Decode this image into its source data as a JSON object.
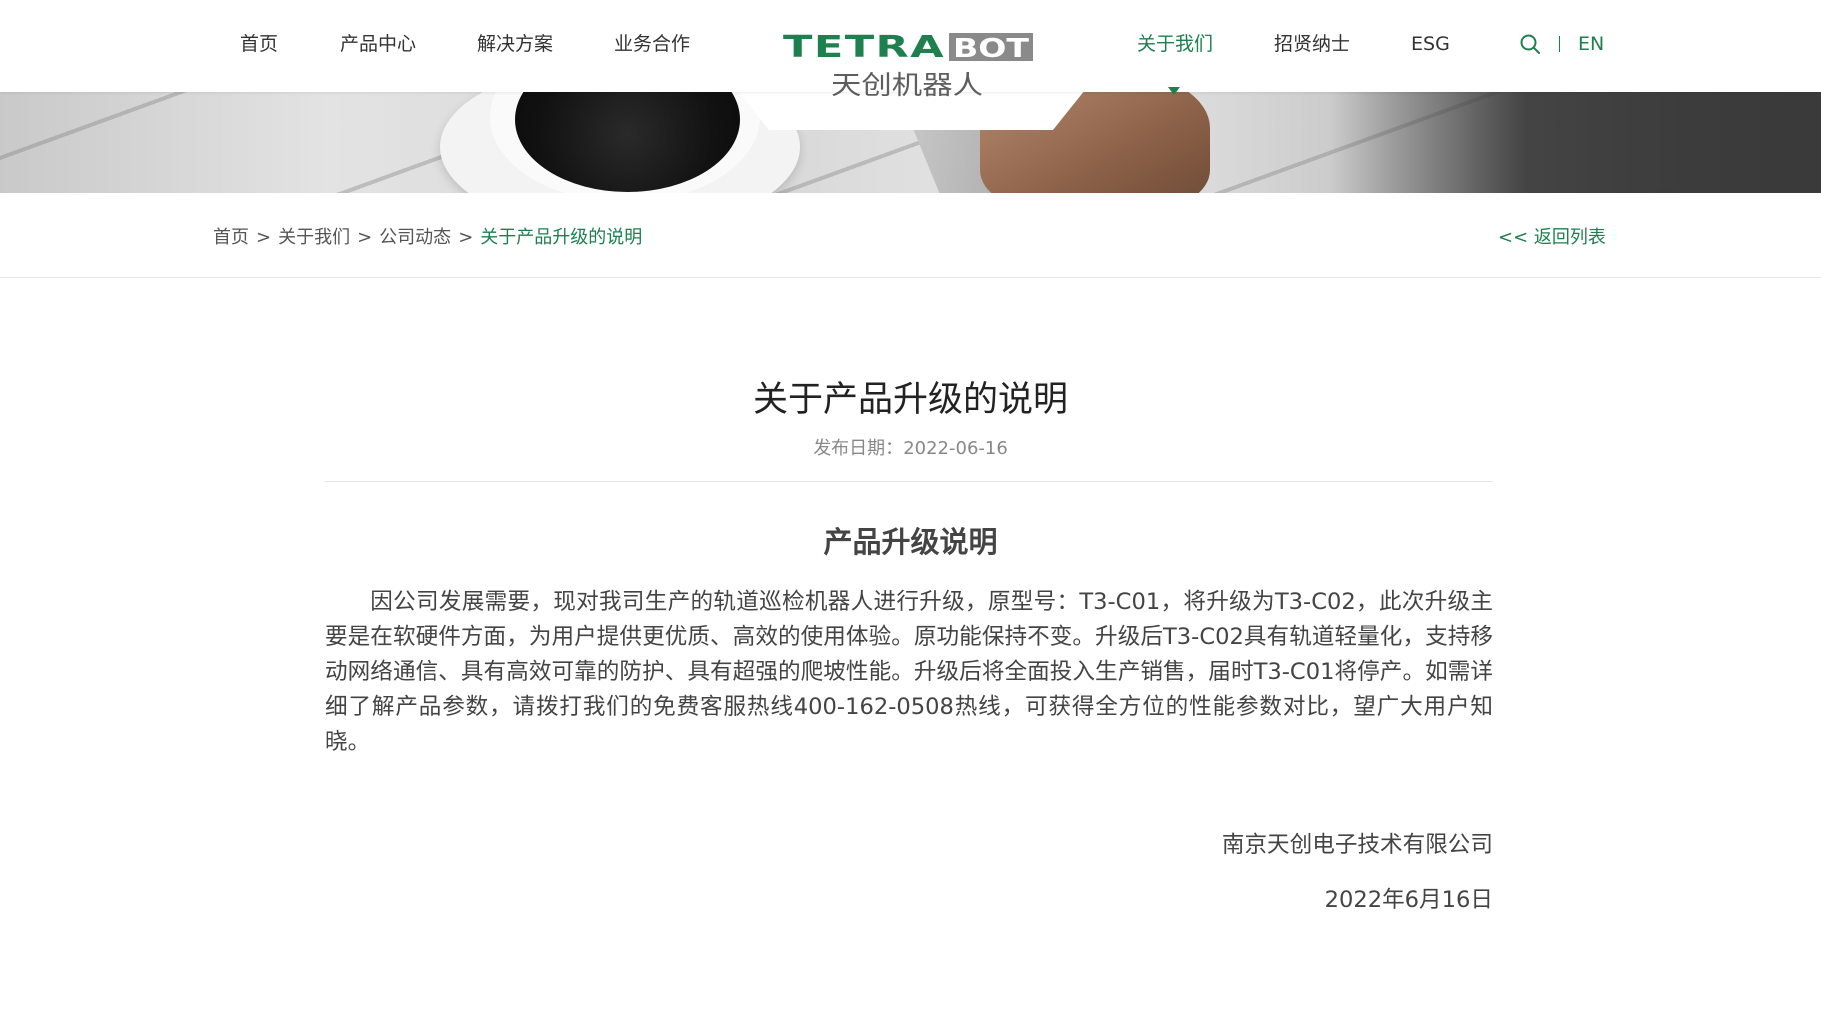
{
  "header": {
    "nav_left": [
      "首页",
      "产品中心",
      "解决方案",
      "业务合作"
    ],
    "nav_right": [
      "关于我们",
      "招贤纳士",
      "ESG"
    ],
    "active_nav": "关于我们",
    "logo": {
      "en": "TETRABOT",
      "cn": "天创机器人"
    },
    "lang": "EN",
    "icons": {
      "search": "search-icon"
    },
    "colors": {
      "accent": "#1e7f4f",
      "logo_green": "#1e7f4f",
      "logo_gray": "#8a8a8a"
    }
  },
  "breadcrumb": {
    "items": [
      "首页",
      "关于我们",
      "公司动态"
    ],
    "separator": ">",
    "current": "关于产品升级的说明"
  },
  "back_link": "<< 返回列表",
  "article": {
    "title": "关于产品升级的说明",
    "date_label": "发布日期：",
    "date": "2022-06-16",
    "subheading": "产品升级说明",
    "body": "因公司发展需要，现对我司生产的轨道巡检机器人进行升级，原型号：T3-C01，将升级为T3-C02，此次升级主要是在软硬件方面，为用户提供更优质、高效的使用体验。原功能保持不变。升级后T3-C02具有轨道轻量化，支持移动网络通信、具有高效可靠的防护、具有超强的爬坡性能。升级后将全面投入生产销售，届时T3-C01将停产。如需详细了解产品参数，请拨打我们的免费客服热线400-162-0508热线，可获得全方位的性能参数对比，望广大用户知晓。",
    "signature_company": "南京天创电子技术有限公司",
    "signature_date": "2022年6月16日"
  }
}
